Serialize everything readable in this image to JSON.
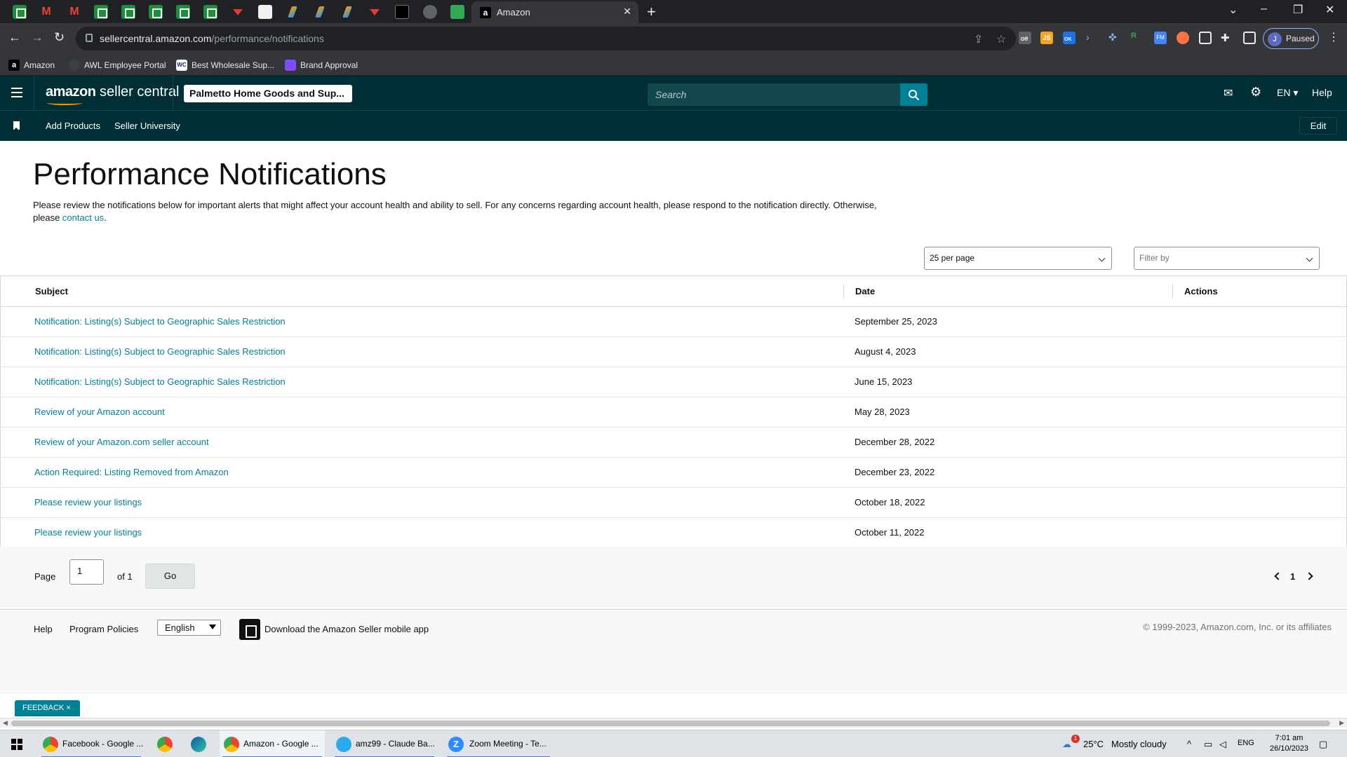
{
  "browser": {
    "active_tab_title": "Amazon",
    "url_host": "sellercentral.amazon.com",
    "url_path": "/performance/notifications",
    "profile_initial": "J",
    "profile_status": "Paused",
    "extension_labels": {
      "off": "Off",
      "js": "JS",
      "ok": "OK",
      "r": "R",
      "fm": "FM"
    },
    "bookmarks": [
      {
        "label": "Amazon"
      },
      {
        "label": "AWL Employee Portal"
      },
      {
        "label": "Best Wholesale Sup..."
      },
      {
        "label": "Brand Approval"
      }
    ],
    "bookmark_icons": {
      "amazon": "a",
      "wc": "WC"
    }
  },
  "header": {
    "logo_bold": "amazon",
    "logo_light": " seller central",
    "store_name": "Palmetto Home Goods and Sup...",
    "search_placeholder": "Search",
    "language": "EN",
    "help": "Help"
  },
  "subnav": {
    "items": [
      {
        "label": "Add Products"
      },
      {
        "label": "Seller University"
      }
    ],
    "edit_label": "Edit"
  },
  "page": {
    "title": "Performance Notifications",
    "intro_text": "Please review the notifications below for important alerts that might affect your account health and ability to sell. For any concerns regarding account health, please respond to the notification directly. Otherwise, please ",
    "intro_link": "contact us",
    "intro_end": ".",
    "per_page": "25 per page",
    "filter_placeholder": "Filter by"
  },
  "table": {
    "headers": {
      "subject": "Subject",
      "date": "Date",
      "actions": "Actions"
    },
    "rows": [
      {
        "subject": "Notification: Listing(s) Subject to Geographic Sales Restriction",
        "date": "September 25, 2023"
      },
      {
        "subject": "Notification: Listing(s) Subject to Geographic Sales Restriction",
        "date": "August 4, 2023"
      },
      {
        "subject": "Notification: Listing(s) Subject to Geographic Sales Restriction",
        "date": "June 15, 2023"
      },
      {
        "subject": "Review of your Amazon account",
        "date": "May 28, 2023"
      },
      {
        "subject": "Review of your Amazon.com seller account",
        "date": "December 28, 2022"
      },
      {
        "subject": "Action Required: Listing Removed from Amazon",
        "date": "December 23, 2022"
      },
      {
        "subject": "Please review your listings",
        "date": "October 18, 2022"
      },
      {
        "subject": "Please review your listings",
        "date": "October 11, 2022"
      }
    ]
  },
  "pagination": {
    "page_label": "Page",
    "page_value": "1",
    "of_label": "of 1",
    "go_label": "Go",
    "current_page": "1"
  },
  "footer": {
    "help": "Help",
    "program_policies": "Program Policies",
    "language": "English",
    "app_text": "Download the Amazon Seller mobile app",
    "copyright": "© 1999-2023, Amazon.com, Inc. or its affiliates"
  },
  "feedback": {
    "label": "FEEDBACK",
    "close": "×"
  },
  "taskbar": {
    "items": [
      {
        "label": "Facebook - Google ..."
      },
      {
        "label": "Amazon - Google ..."
      },
      {
        "label": "amz99 - Claude Ba..."
      },
      {
        "label": "Zoom Meeting - Te..."
      }
    ],
    "weather_badge": "1",
    "temperature": "25°C",
    "weather": "Mostly cloudy",
    "language": "ENG",
    "time": "7:01 am",
    "date": "26/10/2023"
  }
}
